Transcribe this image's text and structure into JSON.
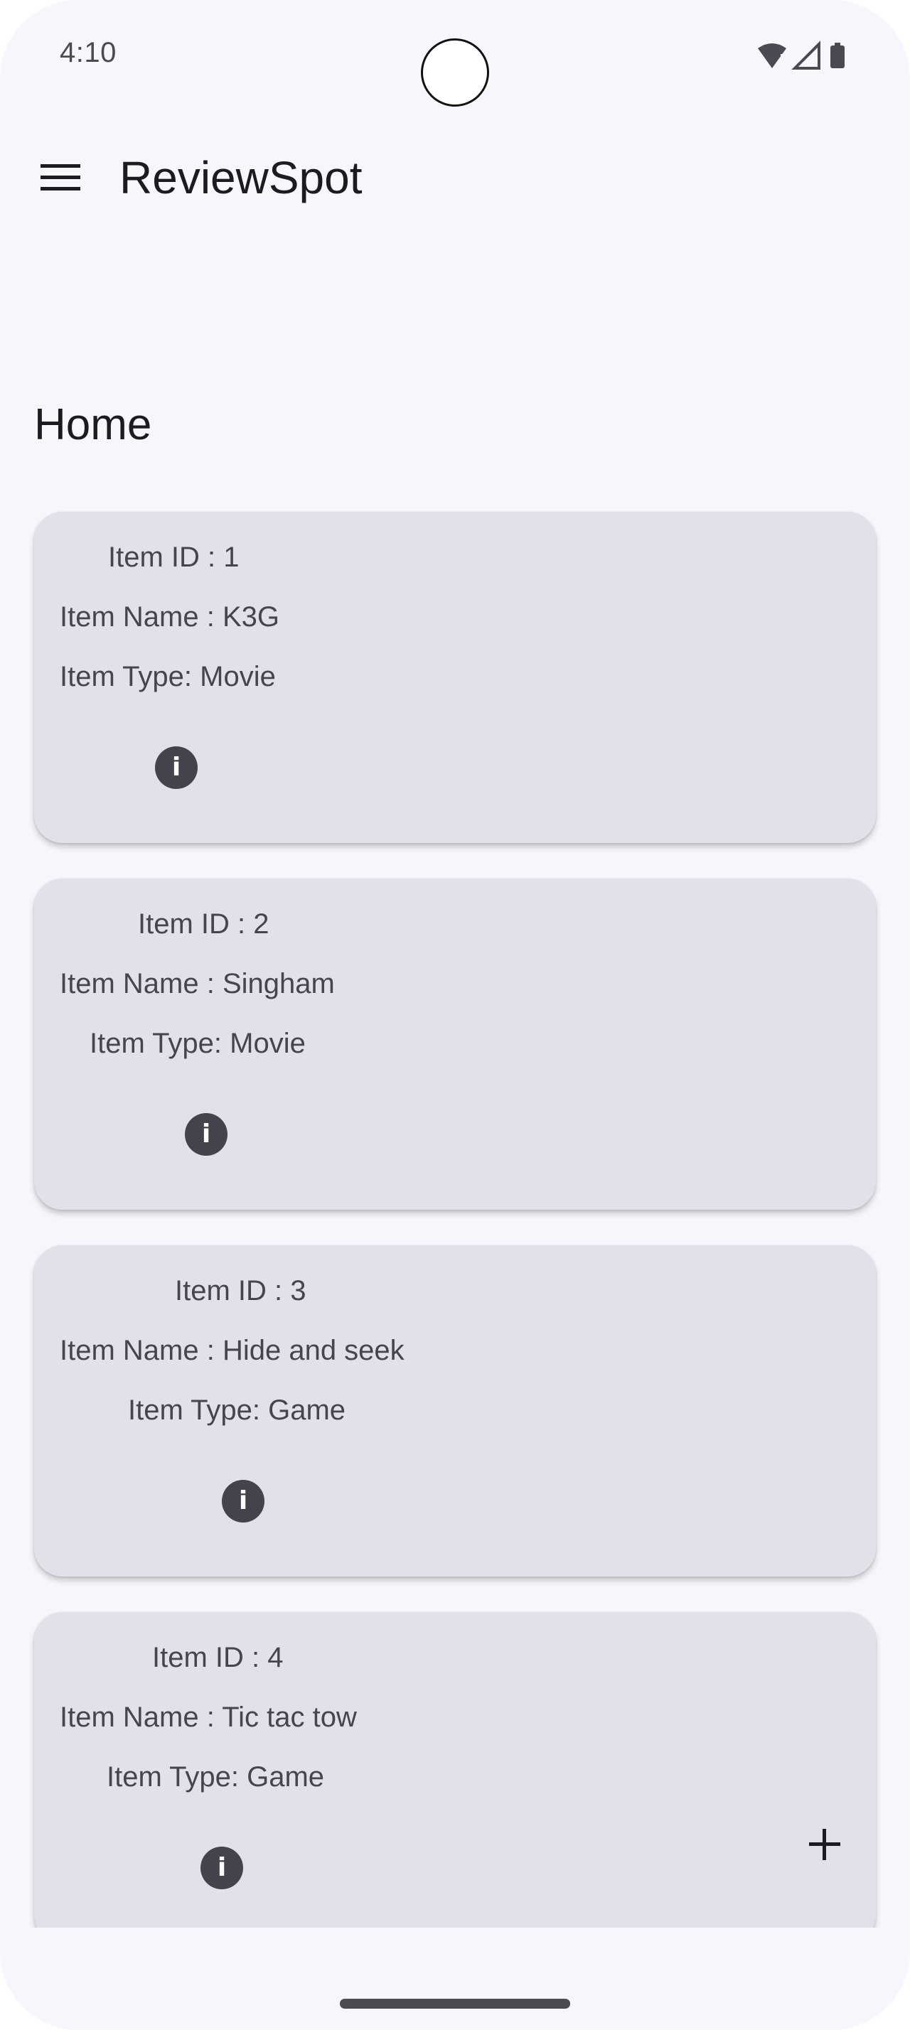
{
  "status_bar": {
    "time": "4:10",
    "icons": [
      "wifi-icon",
      "signal-icon",
      "battery-icon"
    ]
  },
  "app_bar": {
    "menu_icon": "hamburger-menu-icon",
    "title": "ReviewSpot"
  },
  "page": {
    "heading": "Home"
  },
  "items": [
    {
      "id_text": "Item ID : 1",
      "name_text": "Item Name : K3G",
      "type_text": "Item Type: Movie"
    },
    {
      "id_text": "Item ID : 2",
      "name_text": "Item Name : Singham",
      "type_text": "Item Type: Movie"
    },
    {
      "id_text": "Item ID : 3",
      "name_text": "Item Name : Hide and seek",
      "type_text": "Item Type: Game"
    },
    {
      "id_text": "Item ID : 4",
      "name_text": "Item Name : Tic tac tow",
      "type_text": "Item Type: Game"
    }
  ],
  "info_icon": {
    "glyph": "i",
    "name": "info-icon"
  },
  "fab": {
    "icon": "add-icon"
  },
  "colors": {
    "background": "#f7f6fc",
    "card": "#e2e1ea",
    "text": "#46454f",
    "icon_dark": "#44434c"
  }
}
